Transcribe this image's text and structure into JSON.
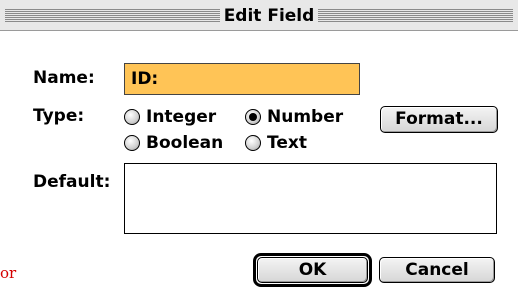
{
  "dialog": {
    "title": "Edit Field"
  },
  "form": {
    "name_label": "Name:",
    "name_value": "ID:",
    "type_label": "Type:",
    "type_options": [
      {
        "label": "Integer",
        "selected": false
      },
      {
        "label": "Number",
        "selected": true
      },
      {
        "label": "Boolean",
        "selected": false
      },
      {
        "label": "Text",
        "selected": false
      }
    ],
    "format_button": "Format...",
    "default_label": "Default:",
    "default_value": ""
  },
  "buttons": {
    "ok": "OK",
    "cancel": "Cancel"
  },
  "edge_text": "or",
  "colors": {
    "name_field_bg": "#ffc456",
    "edge_text": "#d40000"
  }
}
